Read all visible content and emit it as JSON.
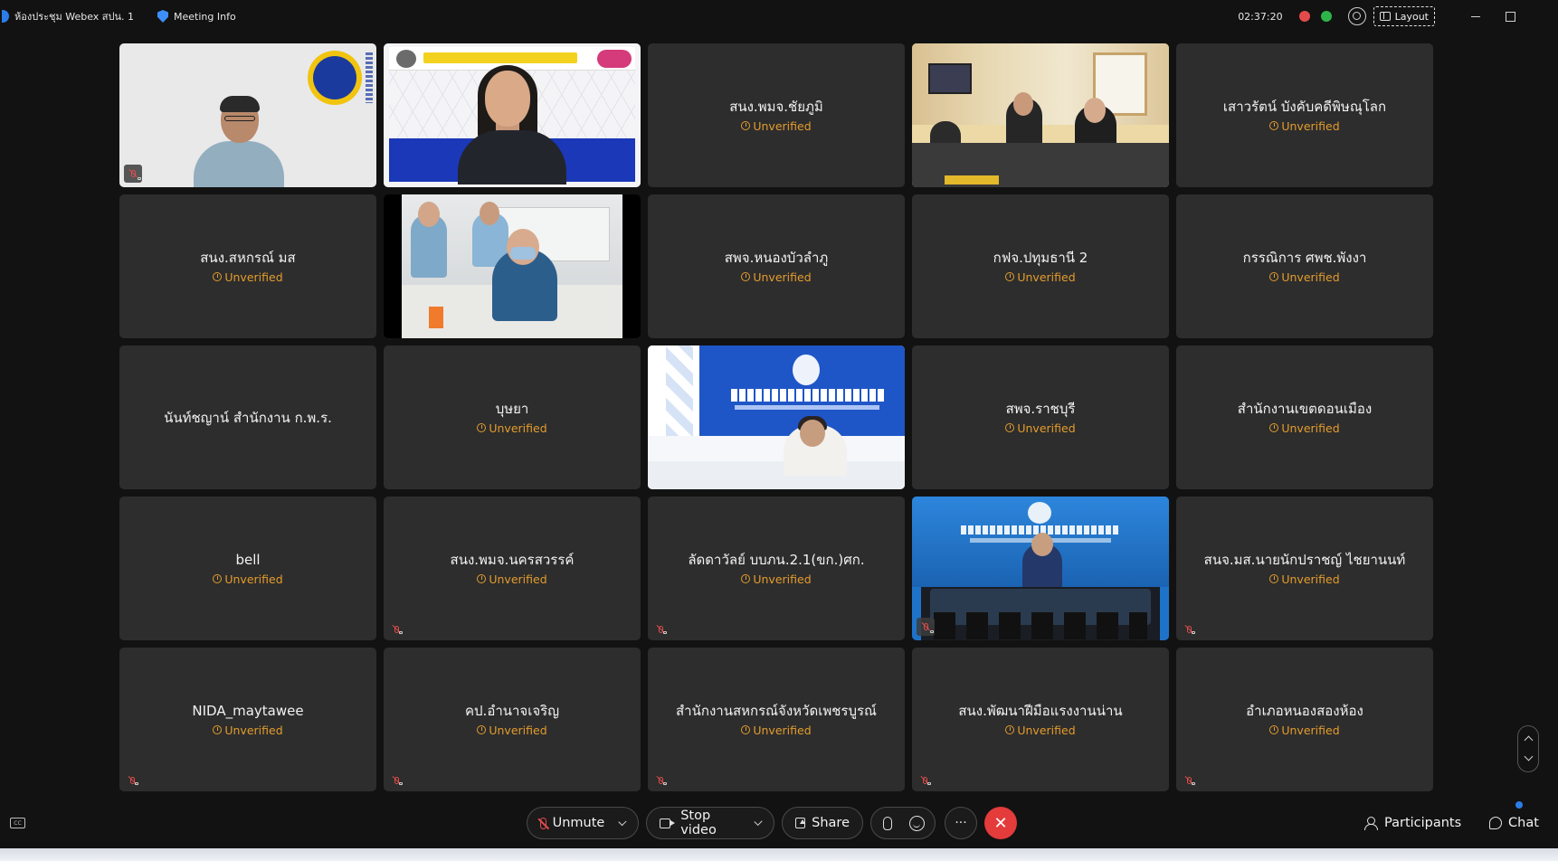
{
  "window": {
    "title": "ห้องประชุม Webex สปน. 1",
    "meeting_info": "Meeting Info",
    "elapsed": "02:37:20",
    "layout_label": "Layout"
  },
  "participants": [
    {
      "name": "",
      "status": "",
      "video": "v1",
      "muted": true,
      "active": false
    },
    {
      "name": "",
      "status": "",
      "video": "v2",
      "muted": false,
      "active": true
    },
    {
      "name": "สนง.พมจ.ชัยภูมิ",
      "status": "Unverified",
      "video": "",
      "muted": false,
      "active": false
    },
    {
      "name": "",
      "status": "",
      "video": "v3",
      "muted": false,
      "active": false
    },
    {
      "name": "เสาวรัตน์ บังคับคดีพิษณุโลก",
      "status": "Unverified",
      "video": "",
      "muted": false,
      "active": false
    },
    {
      "name": "สนง.สหกรณ์ มส",
      "status": "Unverified",
      "video": "",
      "muted": false,
      "active": false
    },
    {
      "name": "",
      "status": "",
      "video": "v4",
      "muted": false,
      "active": false
    },
    {
      "name": "สพจ.หนองบัวลำภู",
      "status": "Unverified",
      "video": "",
      "muted": false,
      "active": false
    },
    {
      "name": "กฟจ.ปทุมธานี 2",
      "status": "Unverified",
      "video": "",
      "muted": false,
      "active": false
    },
    {
      "name": "กรรณิการ ศพช.พังงา",
      "status": "Unverified",
      "video": "",
      "muted": false,
      "active": false
    },
    {
      "name": "นันท์ชญาน์ สำนักงาน ก.พ.ร.",
      "status": "",
      "video": "",
      "muted": false,
      "active": false
    },
    {
      "name": "บุษยา",
      "status": "Unverified",
      "video": "",
      "muted": false,
      "active": false
    },
    {
      "name": "",
      "status": "",
      "video": "v5",
      "muted": false,
      "active": false
    },
    {
      "name": "สพจ.ราชบุรี",
      "status": "Unverified",
      "video": "",
      "muted": false,
      "active": false
    },
    {
      "name": "สำนักงานเขตดอนเมือง",
      "status": "Unverified",
      "video": "",
      "muted": false,
      "active": false
    },
    {
      "name": "bell",
      "status": "Unverified",
      "video": "",
      "muted": false,
      "active": false
    },
    {
      "name": "สนง.พมจ.นครสวรรค์",
      "status": "Unverified",
      "video": "",
      "muted": true,
      "active": false
    },
    {
      "name": "ลัดดาวัลย์ บบภน.2.1(ขก.)ศก.",
      "status": "Unverified",
      "video": "",
      "muted": true,
      "active": false
    },
    {
      "name": "",
      "status": "",
      "video": "v6",
      "muted": true,
      "active": false
    },
    {
      "name": "สนจ.มส.นายนักปราชญ์ ไชยานนท์",
      "status": "Unverified",
      "video": "",
      "muted": true,
      "active": false
    },
    {
      "name": "NIDA_maytawee",
      "status": "Unverified",
      "video": "",
      "muted": true,
      "active": false
    },
    {
      "name": "คป.อำนาจเจริญ",
      "status": "Unverified",
      "video": "",
      "muted": true,
      "active": false
    },
    {
      "name": "สำนักงานสหกรณ์จังหวัดเพชรบูรณ์",
      "status": "Unverified",
      "video": "",
      "muted": true,
      "active": false
    },
    {
      "name": "สนง.พัฒนาฝีมือแรงงานน่าน",
      "status": "Unverified",
      "video": "",
      "muted": true,
      "active": false
    },
    {
      "name": "อำเภอหนองสองห้อง",
      "status": "Unverified",
      "video": "",
      "muted": true,
      "active": false
    }
  ],
  "toolbar": {
    "unmute_label": "Unmute",
    "stop_video_label": "Stop video",
    "share_label": "Share",
    "more_label": "···",
    "end_label": "✕",
    "participants_label": "Participants",
    "chat_label": "Chat",
    "cc_label": "CC"
  },
  "colors": {
    "background": "#121212",
    "tile": "#2d2d2d",
    "unverified": "#e49c2c",
    "active_speaker": "#27a59a",
    "end_call": "#e43b3b"
  },
  "icons": [
    "webex-app-icon",
    "shield-icon",
    "recording-icon",
    "connection-icon",
    "search-icon",
    "grid-icon",
    "minimize-icon",
    "restore-icon",
    "mic-off-icon",
    "camera-icon",
    "share-icon",
    "hand-icon",
    "reaction-icon",
    "more-icon",
    "end-call-icon",
    "people-icon",
    "chat-icon",
    "captions-icon"
  ]
}
